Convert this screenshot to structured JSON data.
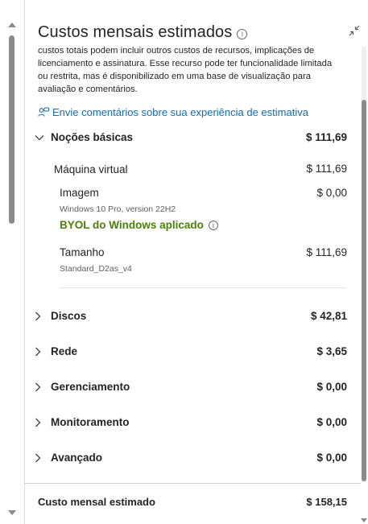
{
  "panel": {
    "title": "Custos mensais estimados",
    "description": "custos totais podem incluir outros custos de recursos, implicações de licenciamento e assinatura. Esse recurso pode ter funcionalidade limitada ou restrita, mas é disponibilizado em uma base de visualização para avaliação e comentários.",
    "feedback_link": "Envie comentários sobre sua experiência de estimativa"
  },
  "sections": {
    "basics": {
      "label": "Noções básicas",
      "value": "$ 111,69",
      "vm": {
        "label": "Máquina virtual",
        "value": "$ 111,69"
      },
      "image": {
        "label": "Imagem",
        "value": "$ 0,00",
        "detail": "Windows 10 Pro, version 22H2",
        "byol": "BYOL do Windows aplicado"
      },
      "size": {
        "label": "Tamanho",
        "value": "$ 111,69",
        "detail": "Standard_D2as_v4"
      }
    },
    "disks": {
      "label": "Discos",
      "value": "$ 42,81"
    },
    "network": {
      "label": "Rede",
      "value": "$ 3,65"
    },
    "management": {
      "label": "Gerenciamento",
      "value": "$ 0,00"
    },
    "monitoring": {
      "label": "Monitoramento",
      "value": "$ 0,00"
    },
    "advanced": {
      "label": "Avançado",
      "value": "$ 0,00"
    }
  },
  "footer": {
    "label": "Custo mensal estimado",
    "value": "$ 158,15"
  },
  "colors": {
    "link": "#0f6cbd",
    "byol": "#498205",
    "text": "#242424"
  },
  "icons": {
    "info": "info-icon",
    "collapse": "collapse-icon",
    "feedback": "person-feedback-icon",
    "chevron_down": "chevron-down-icon",
    "chevron_right": "chevron-right-icon"
  }
}
